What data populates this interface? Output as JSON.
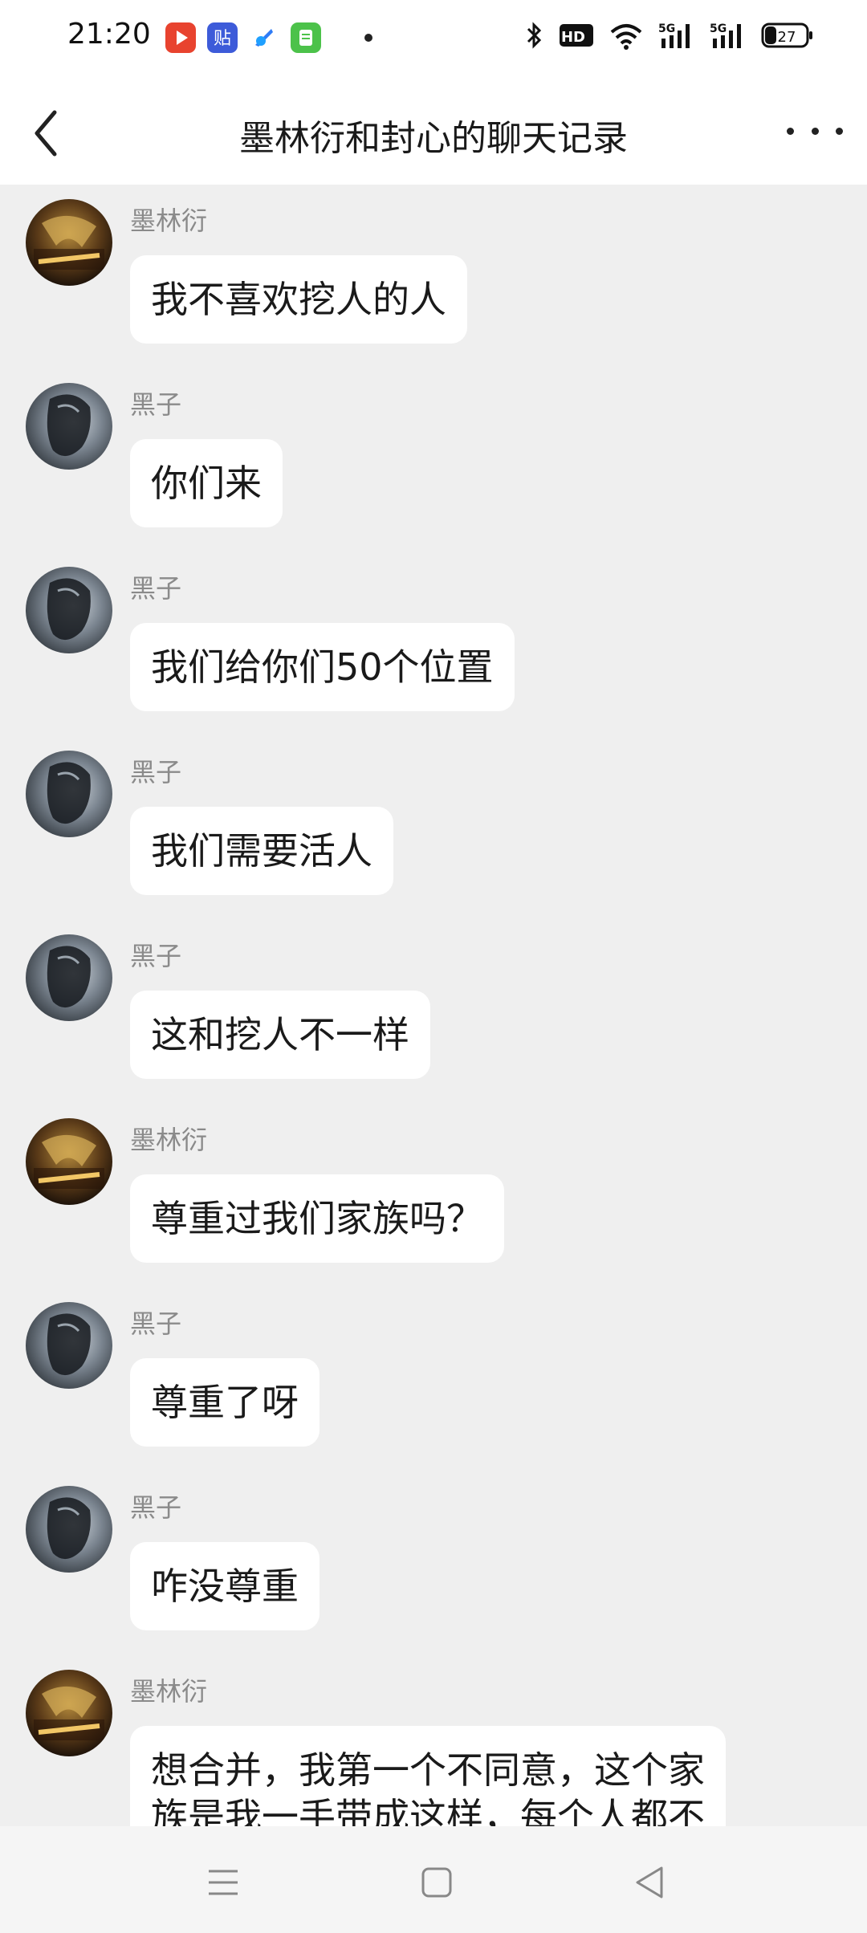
{
  "status_bar": {
    "time": "21:20",
    "battery": "27",
    "network_label": "5G",
    "hd_label": "HD"
  },
  "header": {
    "title": "墨林衍和封心的聊天记录"
  },
  "messages": [
    {
      "sender": "墨林衍",
      "text": "我不喜欢挖人的人",
      "avatar": "warrior"
    },
    {
      "sender": "黑子",
      "text": "你们来",
      "avatar": "dark"
    },
    {
      "sender": "黑子",
      "text": "我们给你们50个位置",
      "avatar": "dark"
    },
    {
      "sender": "黑子",
      "text": "我们需要活人",
      "avatar": "dark"
    },
    {
      "sender": "黑子",
      "text": "这和挖人不一样",
      "avatar": "dark"
    },
    {
      "sender": "墨林衍",
      "text": "尊重过我们家族吗？",
      "avatar": "warrior"
    },
    {
      "sender": "黑子",
      "text": "尊重了呀",
      "avatar": "dark"
    },
    {
      "sender": "黑子",
      "text": "咋没尊重",
      "avatar": "dark"
    },
    {
      "sender": "墨林衍",
      "text": "想合并，我第一个不同意，这个家族是我一手带成这样，每个人都不",
      "avatar": "warrior"
    }
  ],
  "colors": {
    "chat_bg": "#efefef",
    "bubble": "#ffffff",
    "sender": "#8a8a8a"
  }
}
